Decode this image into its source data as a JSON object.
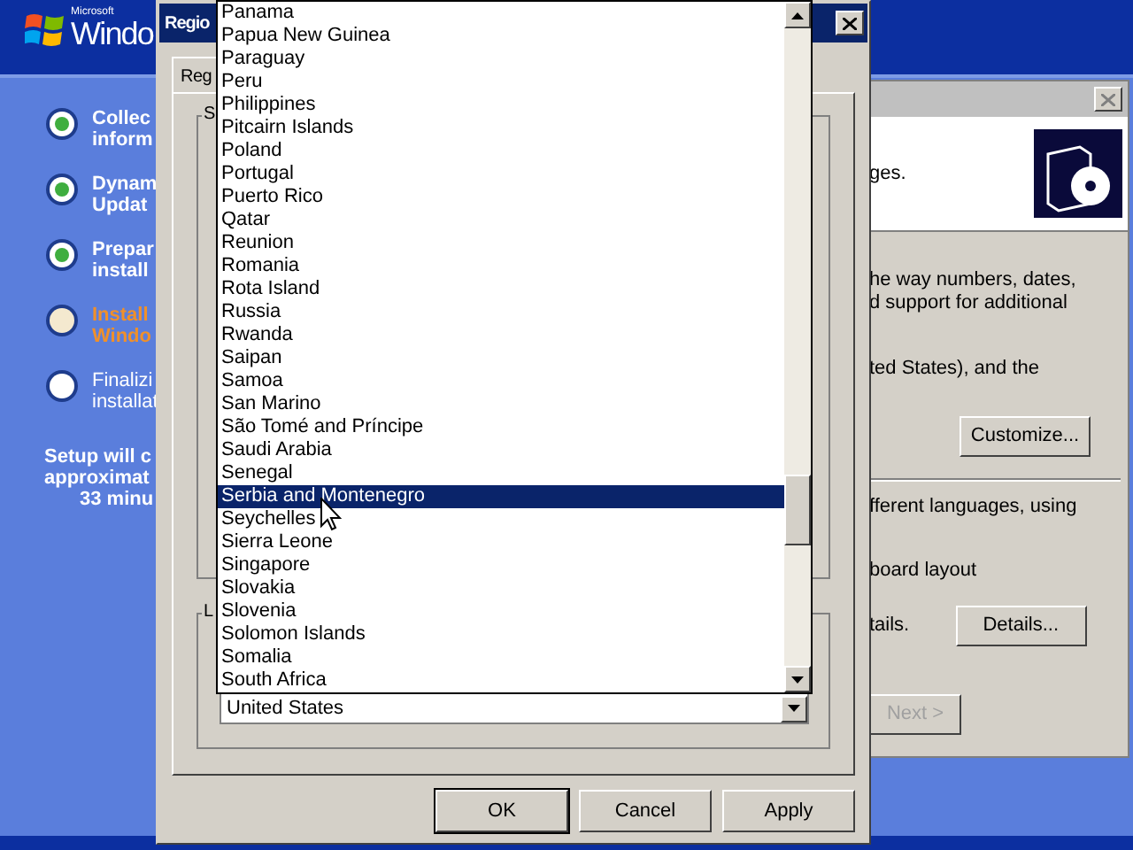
{
  "setup": {
    "logo": {
      "small": "Microsoft",
      "large": "Windo"
    },
    "steps": [
      {
        "lines": [
          "Collec",
          "inform"
        ],
        "kind": "done"
      },
      {
        "lines": [
          "Dynam",
          "Updat"
        ],
        "kind": "done"
      },
      {
        "lines": [
          "Prepar",
          "install"
        ],
        "kind": "done"
      },
      {
        "lines": [
          "Install",
          "Windo"
        ],
        "kind": "current"
      },
      {
        "lines": [
          "Finalizi",
          "installat"
        ],
        "kind": "pending"
      }
    ],
    "estimate": [
      "Setup will c",
      "approximat",
      "33 minu"
    ]
  },
  "back_window": {
    "header_text": "ges.",
    "lines_1": [
      "he way numbers, dates,",
      "d support for additional"
    ],
    "line_2": "ted States), and the",
    "customize_button": "Customize...",
    "lines_3": [
      "fferent languages, using"
    ],
    "line_4": "board layout",
    "line_5": "tails.",
    "details_button": "Details...",
    "next_button": {
      "label": "Next >",
      "disabled": true
    }
  },
  "dialog": {
    "title": "Regio",
    "tab": "Reg",
    "group_1_label": "S",
    "group_2_label": "L",
    "combo_value": "United States",
    "buttons": [
      "OK",
      "Cancel",
      "Apply"
    ]
  },
  "dropdown": {
    "items": [
      {
        "label": "Panama",
        "selected": false
      },
      {
        "label": "Papua New Guinea",
        "selected": false
      },
      {
        "label": "Paraguay",
        "selected": false
      },
      {
        "label": "Peru",
        "selected": false
      },
      {
        "label": "Philippines",
        "selected": false
      },
      {
        "label": "Pitcairn Islands",
        "selected": false
      },
      {
        "label": "Poland",
        "selected": false
      },
      {
        "label": "Portugal",
        "selected": false
      },
      {
        "label": "Puerto Rico",
        "selected": false
      },
      {
        "label": "Qatar",
        "selected": false
      },
      {
        "label": "Reunion",
        "selected": false
      },
      {
        "label": "Romania",
        "selected": false
      },
      {
        "label": "Rota Island",
        "selected": false
      },
      {
        "label": "Russia",
        "selected": false
      },
      {
        "label": "Rwanda",
        "selected": false
      },
      {
        "label": "Saipan",
        "selected": false
      },
      {
        "label": "Samoa",
        "selected": false
      },
      {
        "label": "San Marino",
        "selected": false
      },
      {
        "label": "São Tomé and Príncipe",
        "selected": false
      },
      {
        "label": "Saudi Arabia",
        "selected": false
      },
      {
        "label": "Senegal",
        "selected": false
      },
      {
        "label": "Serbia and Montenegro",
        "selected": true
      },
      {
        "label": "Seychelles",
        "selected": false
      },
      {
        "label": "Sierra Leone",
        "selected": false
      },
      {
        "label": "Singapore",
        "selected": false
      },
      {
        "label": "Slovakia",
        "selected": false
      },
      {
        "label": "Slovenia",
        "selected": false
      },
      {
        "label": "Solomon Islands",
        "selected": false
      },
      {
        "label": "Somalia",
        "selected": false
      },
      {
        "label": "South Africa",
        "selected": false
      }
    ]
  }
}
